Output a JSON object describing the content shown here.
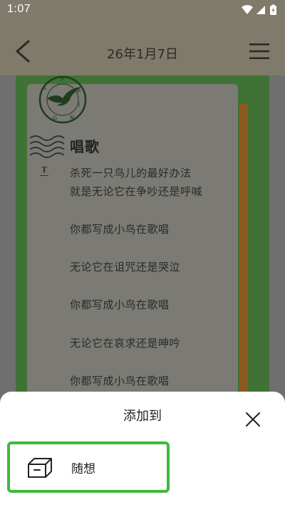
{
  "status_bar": {
    "time": "1:07",
    "icons": [
      "wifi-icon",
      "signal-icon",
      "battery-charging-icon"
    ]
  },
  "header": {
    "back_icon": "chevron-left-icon",
    "title": "26年1月7日",
    "menu_icon": "hamburger-menu-icon"
  },
  "poem": {
    "stamp_letters": [
      "S",
      "P",
      "R",
      "I",
      "N",
      "G"
    ],
    "title": "唱歌",
    "t_marker": "T",
    "lines": [
      "杀死一只鸟儿的最好办法",
      "就是无论它在争吵还是呼喊",
      "你都写成小鸟在歌唱",
      "无论它在诅咒还是哭泣",
      "你都写成小鸟在歌唱",
      "无论它在哀求还是呻吟",
      "你都写成小鸟在歌唱"
    ]
  },
  "sheet": {
    "title": "添加到",
    "close_icon": "close-icon",
    "options": [
      {
        "icon": "box-icon",
        "label": "随想",
        "selected": true
      }
    ]
  },
  "colors": {
    "highlight_border": "#3dba3a",
    "frame_green": "#3f7234",
    "header_bg": "#7f7a6a"
  }
}
